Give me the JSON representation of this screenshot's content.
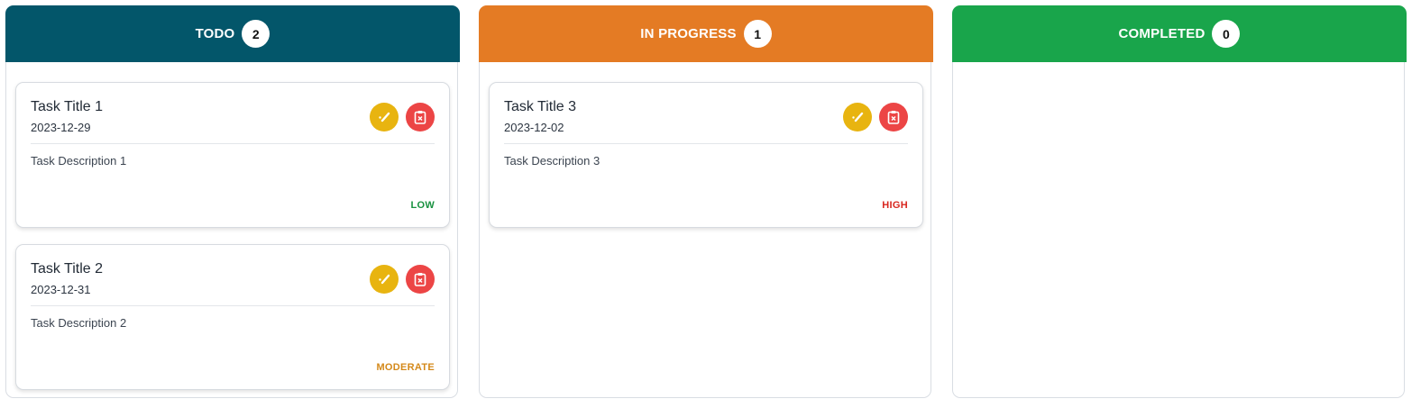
{
  "colors": {
    "todo": "#03566a",
    "in_progress": "#e47b24",
    "completed": "#19a54b",
    "edit_button": "#e8b410",
    "delete_button": "#ec4545",
    "priority_low": "#18913f",
    "priority_moderate": "#d4891a",
    "priority_high": "#d8271f"
  },
  "columns": [
    {
      "title": "TODO",
      "count": "2",
      "tasks": [
        {
          "title": "Task Title 1",
          "date": "2023-12-29",
          "description": "Task Description 1",
          "priority": "LOW",
          "edit_icon": "edit-icon",
          "delete_icon": "clipboard-x-icon"
        },
        {
          "title": "Task Title 2",
          "date": "2023-12-31",
          "description": "Task Description 2",
          "priority": "MODERATE",
          "edit_icon": "edit-icon",
          "delete_icon": "clipboard-x-icon"
        }
      ]
    },
    {
      "title": "IN PROGRESS",
      "count": "1",
      "tasks": [
        {
          "title": "Task Title 3",
          "date": "2023-12-02",
          "description": "Task Description 3",
          "priority": "HIGH",
          "edit_icon": "edit-icon",
          "delete_icon": "clipboard-x-icon"
        }
      ]
    },
    {
      "title": "COMPLETED",
      "count": "0",
      "tasks": []
    }
  ]
}
